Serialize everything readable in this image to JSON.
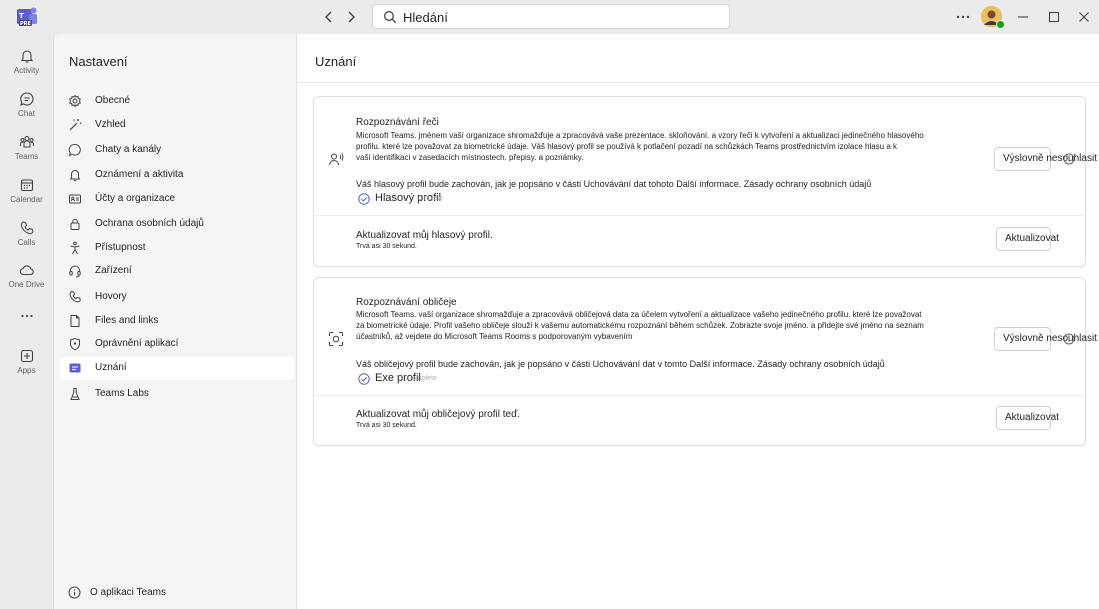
{
  "titlebar": {
    "logo_text": "PRE",
    "back_arrow": "‹",
    "forward_arrow": "›",
    "search_placeholder": "Hledání",
    "more": "···",
    "minimize": "—",
    "maximize": "□",
    "close": "✕"
  },
  "rail": {
    "items": [
      {
        "label": "Activity",
        "icon": "bell-icon"
      },
      {
        "label": "Chat",
        "icon": "chat-icon"
      },
      {
        "label": "Teams",
        "icon": "teams-icon"
      },
      {
        "label": "Calendar",
        "icon": "calendar-icon"
      },
      {
        "label": "Calls",
        "icon": "phone-icon"
      },
      {
        "label": "One Drive",
        "icon": "cloud-icon"
      },
      {
        "label": "",
        "icon": "more-icon"
      },
      {
        "label": "Apps",
        "icon": "apps-icon"
      }
    ],
    "more_glyph": "···"
  },
  "settings": {
    "title": "Nastavení",
    "items": [
      {
        "label": "Obecné",
        "icon": "gear-icon"
      },
      {
        "label": "Vzhled",
        "icon": "magic-wand-icon"
      },
      {
        "label": "Chaty a kanály",
        "icon": "chat-bubble-icon"
      },
      {
        "label": "Oznámení a aktivita",
        "icon": "bell-icon"
      },
      {
        "label": "Účty a organizace",
        "icon": "id-card-icon"
      },
      {
        "label": "Ochrana osobních údajů",
        "icon": "lock-icon"
      },
      {
        "label": "Přístupnost",
        "icon": "accessibility-icon"
      },
      {
        "label": "Zařízení",
        "icon": "headset-icon"
      },
      {
        "label": "Hovory",
        "icon": "phone-icon"
      },
      {
        "label": "Files and links",
        "icon": "file-icon"
      },
      {
        "label": "Oprávnění aplikací",
        "icon": "shield-icon"
      },
      {
        "label": "Uznání",
        "icon": "recognition-icon"
      },
      {
        "label": "Teams Labs",
        "icon": "flask-icon"
      }
    ],
    "active_index": 11,
    "about": "O aplikaci Teams"
  },
  "main": {
    "title": "Uznání",
    "voice": {
      "title": "Rozpoznávání řeči",
      "desc_line1": "Microsoft Teams. jménem vaší organizace shromažďuje a zpracovává vaše prezentace. skloňování. a vzory řeči k vytvoření a aktualizaci jedinečného hlasového",
      "desc_line2": "profilu. které lze považovat za biometrické údaje. Váš hlasový profil se používá k potlačení pozadí na schůzkách Teams prostřednictvím izolace hlasu a k",
      "desc_line3": "vaší identifikaci v zasedacích místnostech. přepisy. a poznámky.",
      "retention": "Váš hlasový profil bude zachován, jak je popsáno v části Uchovávání dat tohoto Další informace. Zásady ochrany osobních údajů",
      "chip_label": "Hlasový profil",
      "chip_ghost": "omplete",
      "decline_button": "Výslovně nesouhlasit",
      "update_title": "Aktualizovat můj hlasový profil.",
      "update_sub": "Trvá asi 30 sekund.",
      "update_button": "Aktualizovat"
    },
    "face": {
      "title": "Rozpoznávání obličeje",
      "desc_line1": "Microsoft Teams. vaší organizace shromažďuje a zpracovává obličejová data za účelem vytvoření a aktualizace vašeho jedinečného profilu. které lze považovat",
      "desc_line2": "za biometrické údaje. Profil vašeho obličeje slouží k vašemu automatickému rozpoznání během schůzek. Zobrazte svoje jméno. a přidejte své jméno na seznam",
      "desc_line3": "účastníků, až vejdete do Microsoft Teams Rooms s podporovaným vybavením",
      "retention": "Váš obličejový profil bude zachován, jak je popsáno v části Uchovávání dat v tomto Další informace. Zásady ochrany osobních údajů",
      "chip_label": "Exe profil",
      "chip_ghost": "omplete",
      "decline_button": "Výslovně nesouhlasit",
      "update_title": "Aktualizovat můj obličejový profil teď.",
      "update_sub": "Trvá asi 30 sekund.",
      "update_button": "Aktualizovat"
    }
  },
  "colors": {
    "brand": "#5b5fc7",
    "background": "#ebebeb",
    "panel": "#f5f5f5",
    "status_green": "#13a10e"
  }
}
